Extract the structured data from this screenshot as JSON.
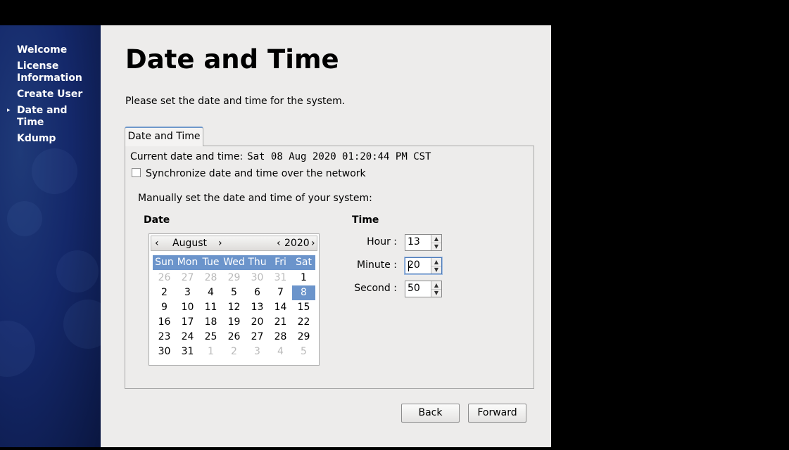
{
  "sidebar": {
    "items": [
      {
        "label": "Welcome",
        "current": false
      },
      {
        "label": "License Information",
        "current": false
      },
      {
        "label": "Create User",
        "current": false
      },
      {
        "label": "Date and Time",
        "current": true
      },
      {
        "label": "Kdump",
        "current": false
      }
    ]
  },
  "page": {
    "title": "Date and Time",
    "subtitle": "Please set the date and time for the system."
  },
  "tab": {
    "label": "Date and Time"
  },
  "current_datetime": {
    "label": "Current date and time:",
    "value": "Sat 08 Aug 2020 01:20:44 PM CST"
  },
  "sync": {
    "label": "Synchronize date and time over the network",
    "checked": false
  },
  "manual_label": "Manually set the date and time of your system:",
  "date_section": {
    "heading": "Date"
  },
  "calendar": {
    "month": "August",
    "year": "2020",
    "prev_month": "‹",
    "next_month": "›",
    "prev_year": "‹",
    "next_year": "›",
    "weekdays": [
      "Sun",
      "Mon",
      "Tue",
      "Wed",
      "Thu",
      "Fri",
      "Sat"
    ],
    "days": [
      {
        "d": "26",
        "m": true
      },
      {
        "d": "27",
        "m": true
      },
      {
        "d": "28",
        "m": true
      },
      {
        "d": "29",
        "m": true
      },
      {
        "d": "30",
        "m": true
      },
      {
        "d": "31",
        "m": true
      },
      {
        "d": "1",
        "m": false
      },
      {
        "d": "2",
        "m": false
      },
      {
        "d": "3",
        "m": false
      },
      {
        "d": "4",
        "m": false
      },
      {
        "d": "5",
        "m": false
      },
      {
        "d": "6",
        "m": false
      },
      {
        "d": "7",
        "m": false
      },
      {
        "d": "8",
        "m": false,
        "sel": true
      },
      {
        "d": "9",
        "m": false
      },
      {
        "d": "10",
        "m": false
      },
      {
        "d": "11",
        "m": false
      },
      {
        "d": "12",
        "m": false
      },
      {
        "d": "13",
        "m": false
      },
      {
        "d": "14",
        "m": false
      },
      {
        "d": "15",
        "m": false
      },
      {
        "d": "16",
        "m": false
      },
      {
        "d": "17",
        "m": false
      },
      {
        "d": "18",
        "m": false
      },
      {
        "d": "19",
        "m": false
      },
      {
        "d": "20",
        "m": false
      },
      {
        "d": "21",
        "m": false
      },
      {
        "d": "22",
        "m": false
      },
      {
        "d": "23",
        "m": false
      },
      {
        "d": "24",
        "m": false
      },
      {
        "d": "25",
        "m": false
      },
      {
        "d": "26",
        "m": false
      },
      {
        "d": "27",
        "m": false
      },
      {
        "d": "28",
        "m": false
      },
      {
        "d": "29",
        "m": false
      },
      {
        "d": "30",
        "m": false
      },
      {
        "d": "31",
        "m": false
      },
      {
        "d": "1",
        "m": true
      },
      {
        "d": "2",
        "m": true
      },
      {
        "d": "3",
        "m": true
      },
      {
        "d": "4",
        "m": true
      },
      {
        "d": "5",
        "m": true
      }
    ]
  },
  "time_section": {
    "heading": "Time",
    "hour_label": "Hour :",
    "hour_value": "13",
    "minute_label": "Minute :",
    "minute_value": "20",
    "second_label": "Second :",
    "second_value": "50"
  },
  "buttons": {
    "back": "Back",
    "forward": "Forward"
  },
  "colors": {
    "accent": "#6b94cb",
    "sidebar": "#14286a",
    "panel": "#edeceb"
  }
}
